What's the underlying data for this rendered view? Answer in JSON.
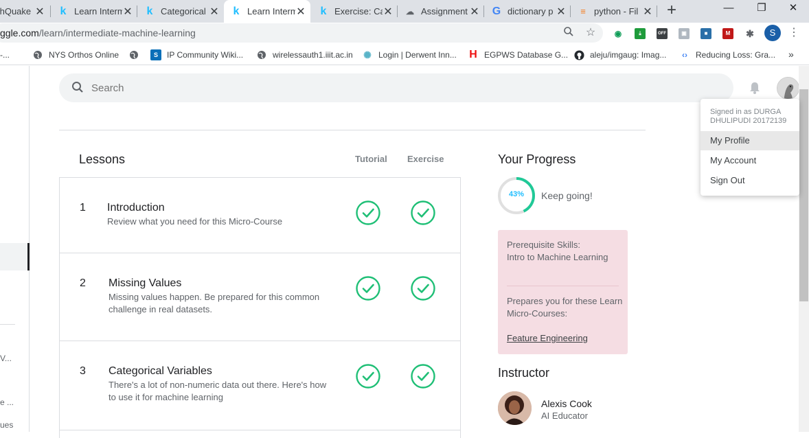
{
  "browser": {
    "tabs": [
      {
        "title": "thQuake",
        "icon": "earth-icon",
        "active": false
      },
      {
        "title": "Learn Interm",
        "icon": "kaggle-icon",
        "active": false
      },
      {
        "title": "Categorical",
        "icon": "kaggle-icon",
        "active": false
      },
      {
        "title": "Learn Interm",
        "icon": "kaggle-icon",
        "active": true
      },
      {
        "title": "Exercise: Ca",
        "icon": "kaggle-icon",
        "active": false
      },
      {
        "title": "Assignment",
        "icon": "cloud-icon",
        "active": false
      },
      {
        "title": "dictionary p",
        "icon": "google-icon",
        "active": false
      },
      {
        "title": "python - Fil",
        "icon": "stackoverflow-icon",
        "active": false
      }
    ],
    "new_tab": "+",
    "url_host": "ggle.com",
    "url_path": "/learn/intermediate-machine-learning",
    "profile_initial": "S",
    "ext_off_label": "OFF",
    "bookmarks": [
      {
        "label": "-...",
        "icon": ""
      },
      {
        "label": "NYS Orthos Online",
        "icon": "globe-icon"
      },
      {
        "label": "IP Community Wiki...",
        "icon": "sharepoint-icon"
      },
      {
        "label": "wirelessauth1.iiit.ac.in",
        "icon": "globe-icon"
      },
      {
        "label": "Login | Derwent Inn...",
        "icon": "derwent-icon"
      },
      {
        "label": "EGPWS Database G...",
        "icon": "honeywell-icon"
      },
      {
        "label": "aleju/imgaug: Imag...",
        "icon": "github-icon"
      },
      {
        "label": "Reducing Loss: Gra...",
        "icon": "google-dev-icon"
      }
    ],
    "bookmarks_more": "»"
  },
  "page": {
    "search_placeholder": "Search",
    "leftnav_fragments": [
      "V...",
      "e ...",
      "ues"
    ],
    "lessons_title": "Lessons",
    "col_tutorial": "Tutorial",
    "col_exercise": "Exercise",
    "lessons": [
      {
        "num": "1",
        "name": "Introduction",
        "desc": "Review what you need for this Micro-Course",
        "tutorial_done": true,
        "exercise_done": true
      },
      {
        "num": "2",
        "name": "Missing Values",
        "desc": "Missing values happen. Be prepared for this common challenge in real datasets.",
        "tutorial_done": true,
        "exercise_done": true
      },
      {
        "num": "3",
        "name": "Categorical Variables",
        "desc": "There's a lot of non-numeric data out there. Here's how to use it for machine learning",
        "tutorial_done": true,
        "exercise_done": true
      }
    ],
    "progress": {
      "title": "Your Progress",
      "percent_label": "43%",
      "percent_value": 43,
      "message": "Keep going!"
    },
    "prereq": {
      "label": "Prerequisite Skills:",
      "skills": "Intro to Machine Learning",
      "prepares_label": "Prepares you for these Learn Micro-Courses:",
      "next_course": "Feature Engineering"
    },
    "instructor": {
      "title": "Instructor",
      "name": "Alexis Cook",
      "role": "AI Educator"
    }
  },
  "user_menu": {
    "signed_in": "Signed in as DURGA DHULIPUDI 20172139",
    "items": [
      "My Profile",
      "My Account",
      "Sign Out"
    ]
  },
  "colors": {
    "accent_green": "#20c997",
    "check_green": "#1fbf76",
    "ring_blue": "#20beff",
    "prereq_bg": "#f5dde3"
  }
}
